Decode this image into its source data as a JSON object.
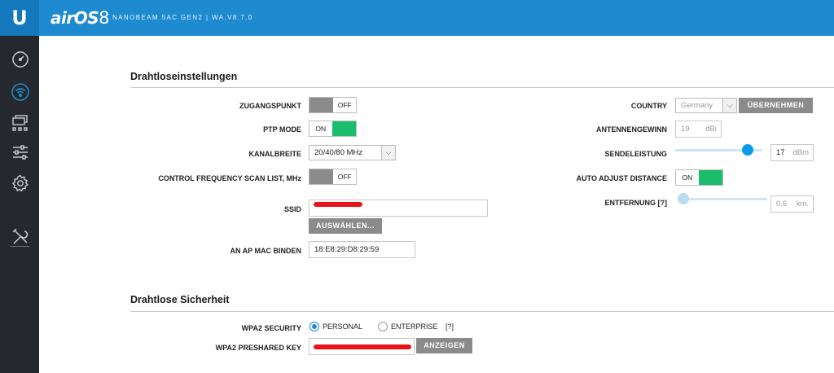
{
  "topbar": {
    "logo": "U",
    "product": "airOS",
    "version_badge": "8",
    "device_info": "NANOBEAM 5AC GEN2 | WA.V8.7.0"
  },
  "sidebar": {
    "items": [
      {
        "name": "dashboard",
        "icon": "speedometer-icon"
      },
      {
        "name": "wireless",
        "icon": "wifi-icon"
      },
      {
        "name": "network",
        "icon": "network-icon"
      },
      {
        "name": "services",
        "icon": "sliders-icon"
      },
      {
        "name": "system",
        "icon": "gear-icon"
      },
      {
        "name": "tools",
        "icon": "tools-icon"
      }
    ],
    "active": "wireless",
    "active_color": "#1e8ad0"
  },
  "wireless": {
    "title": "Drahtloseinstellungen",
    "access_point": {
      "label": "ZUGANGSPUNKT",
      "state": "OFF"
    },
    "ptp_mode": {
      "label": "PTP MODE",
      "state": "ON"
    },
    "channel_width": {
      "label": "KANALBREITE",
      "value": "20/40/80 MHz"
    },
    "scan_list": {
      "label": "CONTROL FREQUENCY SCAN LIST, MHz",
      "state": "OFF"
    },
    "ssid": {
      "label": "SSID",
      "select_button": "AUSWÄHLEN..."
    },
    "ap_mac": {
      "label": "AN AP MAC BINDEN",
      "value": "18:E8:29:D8:29:59"
    },
    "country": {
      "label": "COUNTRY",
      "value": "Germany",
      "apply_button": "ÜBERNEHMEN"
    },
    "antenna_gain": {
      "label": "ANTENNENGEWINN",
      "value": "19",
      "unit": "dBi"
    },
    "tx_power": {
      "label": "SENDELEISTUNG",
      "value": "17",
      "unit": "dBm",
      "level": 0.83
    },
    "auto_distance": {
      "label": "AUTO ADJUST DISTANCE",
      "state": "ON"
    },
    "distance": {
      "label": "ENTFERNUNG [?]",
      "value": "0.6",
      "unit": "km.",
      "level": 0.0
    }
  },
  "security": {
    "title": "Drahtlose Sicherheit",
    "wpa2_security": {
      "label": "WPA2 SECURITY",
      "options": [
        "PERSONAL",
        "ENTERPRISE"
      ],
      "selected": "PERSONAL",
      "help": "[?]"
    },
    "preshared_key": {
      "label": "WPA2 PRESHARED KEY",
      "show_button": "ANZEIGEN"
    }
  },
  "colors": {
    "topbar": "#1e8ad0",
    "sidebar": "#25282c",
    "toggle_on": "#1bbc6b",
    "toggle_off": "#8b8b8b",
    "slider": "#0a9be8",
    "redaction": "#e8141b"
  }
}
